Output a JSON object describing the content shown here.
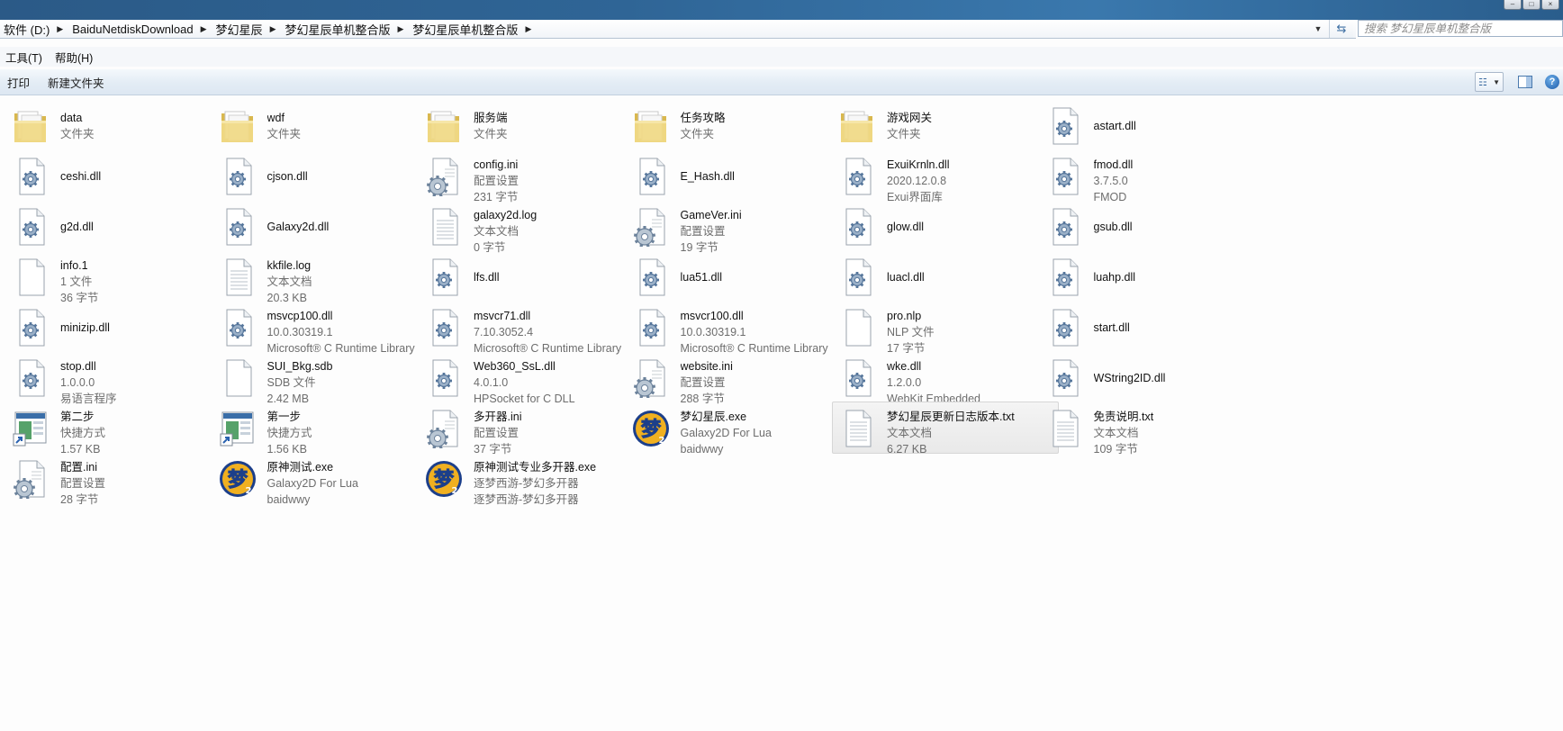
{
  "window": {
    "breadcrumb": [
      "软件 (D:)",
      "BaiduNetdiskDownload",
      "梦幻星辰",
      "梦幻星辰单机整合版",
      "梦幻星辰单机整合版"
    ],
    "search_placeholder": "搜索 梦幻星辰单机整合版"
  },
  "menu": [
    "工具(T)",
    "帮助(H)"
  ],
  "toolbar": {
    "print": "打印",
    "new_folder": "新建文件夹"
  },
  "files": [
    {
      "name": "data",
      "lines": [
        "文件夹"
      ],
      "icon": "folder-icon"
    },
    {
      "name": "wdf",
      "lines": [
        "文件夹"
      ],
      "icon": "folder-icon"
    },
    {
      "name": "服务端",
      "lines": [
        "文件夹"
      ],
      "icon": "folder-icon"
    },
    {
      "name": "任务攻略",
      "lines": [
        "文件夹"
      ],
      "icon": "folder-icon"
    },
    {
      "name": "游戏网关",
      "lines": [
        "文件夹"
      ],
      "icon": "folder-icon"
    },
    {
      "name": "astart.dll",
      "lines": [],
      "icon": "dll-icon"
    },
    {
      "name": "ceshi.dll",
      "lines": [],
      "icon": "dll-icon"
    },
    {
      "name": "cjson.dll",
      "lines": [],
      "icon": "dll-icon"
    },
    {
      "name": "config.ini",
      "lines": [
        "配置设置",
        "231 字节"
      ],
      "icon": "ini-icon"
    },
    {
      "name": "E_Hash.dll",
      "lines": [],
      "icon": "dll-icon"
    },
    {
      "name": "ExuiKrnln.dll",
      "lines": [
        "2020.12.0.8",
        "Exui界面库"
      ],
      "icon": "dll-icon"
    },
    {
      "name": "fmod.dll",
      "lines": [
        "3.7.5.0",
        "FMOD"
      ],
      "icon": "dll-icon"
    },
    {
      "name": "g2d.dll",
      "lines": [],
      "icon": "dll-icon"
    },
    {
      "name": "Galaxy2d.dll",
      "lines": [],
      "icon": "dll-icon"
    },
    {
      "name": "galaxy2d.log",
      "lines": [
        "文本文档",
        "0 字节"
      ],
      "icon": "text-icon"
    },
    {
      "name": "GameVer.ini",
      "lines": [
        "配置设置",
        "19 字节"
      ],
      "icon": "ini-icon"
    },
    {
      "name": "glow.dll",
      "lines": [],
      "icon": "dll-icon"
    },
    {
      "name": "gsub.dll",
      "lines": [],
      "icon": "dll-icon"
    },
    {
      "name": "info.1",
      "lines": [
        "1 文件",
        "36 字节"
      ],
      "icon": "blank-file-icon"
    },
    {
      "name": "kkfile.log",
      "lines": [
        "文本文档",
        "20.3 KB"
      ],
      "icon": "text-icon"
    },
    {
      "name": "lfs.dll",
      "lines": [],
      "icon": "dll-icon"
    },
    {
      "name": "lua51.dll",
      "lines": [],
      "icon": "dll-icon"
    },
    {
      "name": "luacl.dll",
      "lines": [],
      "icon": "dll-icon"
    },
    {
      "name": "luahp.dll",
      "lines": [],
      "icon": "dll-icon"
    },
    {
      "name": "minizip.dll",
      "lines": [],
      "icon": "dll-icon"
    },
    {
      "name": "msvcp100.dll",
      "lines": [
        "10.0.30319.1",
        "Microsoft® C Runtime Library"
      ],
      "icon": "dll-icon"
    },
    {
      "name": "msvcr71.dll",
      "lines": [
        "7.10.3052.4",
        "Microsoft® C Runtime Library"
      ],
      "icon": "dll-icon"
    },
    {
      "name": "msvcr100.dll",
      "lines": [
        "10.0.30319.1",
        "Microsoft® C Runtime Library"
      ],
      "icon": "dll-icon"
    },
    {
      "name": "pro.nlp",
      "lines": [
        "NLP 文件",
        "17 字节"
      ],
      "icon": "blank-file-icon"
    },
    {
      "name": "start.dll",
      "lines": [],
      "icon": "dll-icon"
    },
    {
      "name": "stop.dll",
      "lines": [
        "1.0.0.0",
        "易语言程序"
      ],
      "icon": "dll-icon"
    },
    {
      "name": "SUI_Bkg.sdb",
      "lines": [
        "SDB 文件",
        "2.42 MB"
      ],
      "icon": "blank-file-icon"
    },
    {
      "name": "Web360_SsL.dll",
      "lines": [
        "4.0.1.0",
        "HPSocket for C DLL"
      ],
      "icon": "dll-icon"
    },
    {
      "name": "website.ini",
      "lines": [
        "配置设置",
        "288 字节"
      ],
      "icon": "ini-icon"
    },
    {
      "name": "wke.dll",
      "lines": [
        "1.2.0.0",
        "WebKit Embedded"
      ],
      "icon": "dll-icon"
    },
    {
      "name": "WString2ID.dll",
      "lines": [],
      "icon": "dll-icon"
    },
    {
      "name": "第二步",
      "lines": [
        "快捷方式",
        "1.57 KB"
      ],
      "icon": "shortcut-icon"
    },
    {
      "name": "第一步",
      "lines": [
        "快捷方式",
        "1.56 KB"
      ],
      "icon": "shortcut-icon"
    },
    {
      "name": "多开器.ini",
      "lines": [
        "配置设置",
        "37 字节"
      ],
      "icon": "ini-icon"
    },
    {
      "name": "梦幻星辰.exe",
      "lines": [
        "Galaxy2D For Lua",
        "baidwwy"
      ],
      "icon": "game-exe-icon"
    },
    {
      "name": "梦幻星辰更新日志版本.txt",
      "lines": [
        "文本文档",
        "6.27 KB"
      ],
      "icon": "text-icon",
      "hovered": true
    },
    {
      "name": "免责说明.txt",
      "lines": [
        "文本文档",
        "109 字节"
      ],
      "icon": "text-icon"
    },
    {
      "name": "配置.ini",
      "lines": [
        "配置设置",
        "28 字节"
      ],
      "icon": "ini-icon"
    },
    {
      "name": "原神测试.exe",
      "lines": [
        "Galaxy2D For Lua",
        "baidwwy"
      ],
      "icon": "game-exe-icon"
    },
    {
      "name": "原神测试专业多开器.exe",
      "lines": [
        "逐梦西游-梦幻多开器",
        "逐梦西游-梦幻多开器"
      ],
      "icon": "game-exe-icon"
    }
  ],
  "game_icon_glyph": "梦",
  "colors": {
    "folder": "#e8c96a",
    "gear": "#5a7fa8",
    "accent": "#2f6596"
  }
}
